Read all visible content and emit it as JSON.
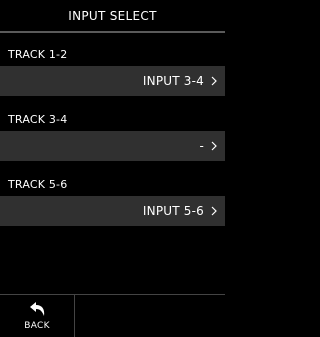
{
  "header": {
    "title": "INPUT SELECT"
  },
  "tracks": [
    {
      "label": "TRACK 1-2",
      "value": "INPUT 3-4"
    },
    {
      "label": "TRACK 3-4",
      "value": "-"
    },
    {
      "label": "TRACK 5-6",
      "value": "INPUT 5-6"
    }
  ],
  "icons": {
    "row_arrow": "chevron-right-icon",
    "back": "back-arrow-icon"
  },
  "footer": {
    "back_label": "BACK"
  },
  "colors": {
    "background": "#000000",
    "row_background": "#303030",
    "text": "#ffffff",
    "divider": "#5a5a5a"
  }
}
